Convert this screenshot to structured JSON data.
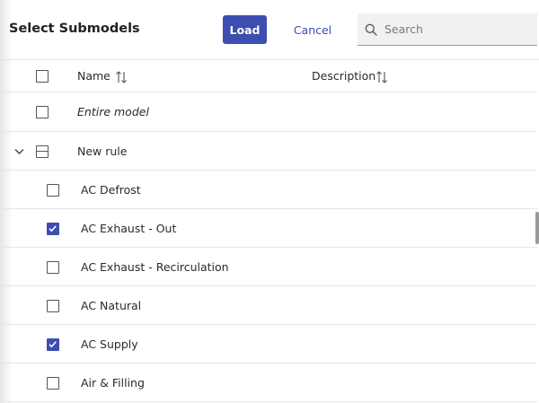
{
  "header": {
    "title": "Select Submodels",
    "load_label": "Load",
    "cancel_label": "Cancel",
    "search_placeholder": "Search"
  },
  "table": {
    "columns": [
      {
        "label": "Name"
      },
      {
        "label": "Description"
      }
    ],
    "entire_model": {
      "label": "Entire model",
      "checked": false
    },
    "group": {
      "label": "New rule",
      "expanded": true,
      "state": "partial"
    },
    "items": [
      {
        "label": "AC Defrost",
        "checked": false
      },
      {
        "label": "AC Exhaust - Out",
        "checked": true
      },
      {
        "label": "AC Exhaust - Recirculation",
        "checked": false
      },
      {
        "label": "AC Natural",
        "checked": false
      },
      {
        "label": "AC Supply",
        "checked": true
      },
      {
        "label": "Air & Filling",
        "checked": false
      }
    ]
  },
  "colors": {
    "accent": "#3d4db0"
  }
}
